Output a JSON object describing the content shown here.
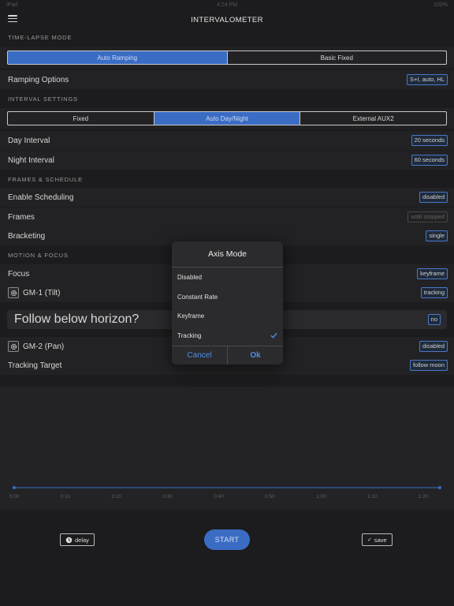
{
  "status_bar": {
    "carrier": "iPad",
    "time": "4:24 PM",
    "battery": "100%"
  },
  "nav": {
    "title": "INTERVALOMETER"
  },
  "sections": {
    "timelapse_mode": "TIME-LAPSE MODE",
    "interval_settings": "INTERVAL SETTINGS",
    "frames_schedule": "FRAMES & SCHEDULE",
    "motion_focus": "MOTION & FOCUS"
  },
  "timelapse_mode": {
    "options": [
      "Auto Ramping",
      "Basic Fixed"
    ],
    "selected": "Auto Ramping"
  },
  "ramping_options": {
    "label": "Ramping Options",
    "value": "S+I, auto, HL"
  },
  "interval_mode": {
    "options": [
      "Fixed",
      "Auto Day/Night",
      "External AUX2"
    ],
    "selected": "Auto Day/Night"
  },
  "day_interval": {
    "label": "Day Interval",
    "value": "20 seconds"
  },
  "night_interval": {
    "label": "Night Interval",
    "value": "60 seconds"
  },
  "enable_scheduling": {
    "label": "Enable Scheduling",
    "value": "disabled"
  },
  "frames": {
    "label": "Frames",
    "value": "until stopped"
  },
  "bracketing": {
    "label": "Bracketing",
    "value": "single"
  },
  "focus": {
    "label": "Focus",
    "value": "keyframe"
  },
  "gm1": {
    "label": "GM-1 (Tilt)",
    "value": "tracking"
  },
  "follow_horizon": {
    "label": "Follow below horizon?",
    "value": "no"
  },
  "gm2": {
    "label": "GM-2 (Pan)",
    "value": "disabled"
  },
  "tracking_target": {
    "label": "Tracking Target",
    "value": "follow moon"
  },
  "timeline": {
    "ticks": [
      "0:00",
      "0:10",
      "0:20",
      "0:30",
      "0:40",
      "0:50",
      "1:00",
      "1:10",
      "1:20"
    ]
  },
  "controls": {
    "delay": "delay",
    "start": "START",
    "save": "save"
  },
  "dialog": {
    "title": "Axis Mode",
    "options": [
      "Disabled",
      "Constant Rate",
      "Keyframe",
      "Tracking"
    ],
    "selected": "Tracking",
    "cancel": "Cancel",
    "ok": "Ok"
  },
  "colors": {
    "accent": "#3a6cc4",
    "link": "#4e8fe8",
    "background": "#1c1c1e"
  }
}
